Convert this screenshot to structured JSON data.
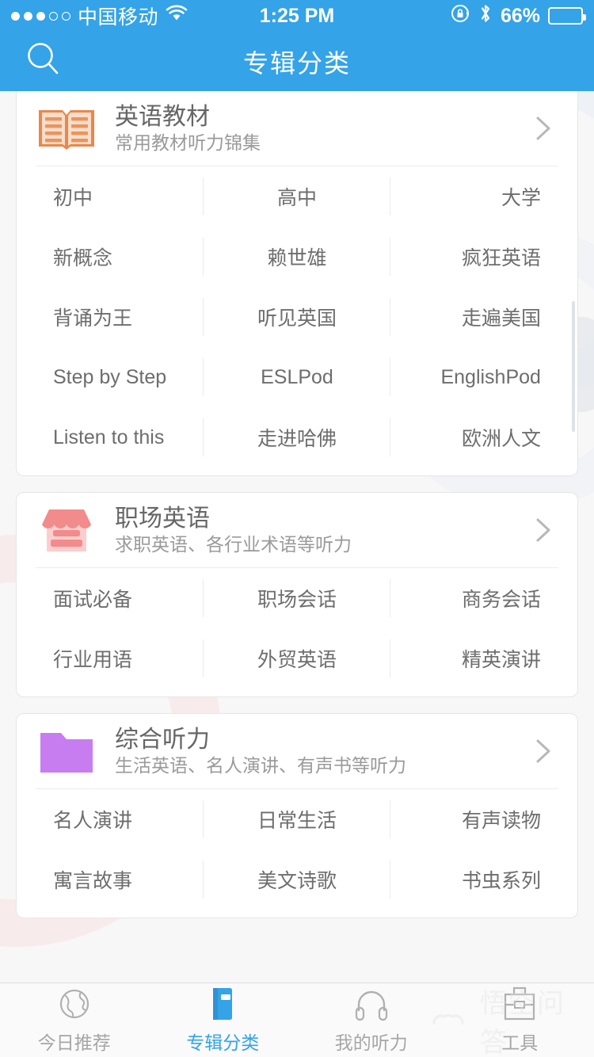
{
  "status_bar": {
    "signal_dots_filled": 3,
    "signal_dots_total": 5,
    "carrier": "中国移动",
    "wifi_icon": "wifi-icon",
    "time": "1:25 PM",
    "rotation_lock_icon": "rotation-lock-icon",
    "bluetooth_icon": "bluetooth-icon",
    "battery_percent": "66%",
    "battery_level": 66
  },
  "navbar": {
    "title": "专辑分类",
    "search_icon": "search-icon"
  },
  "theme": {
    "accent": "#34a3e8",
    "page_bg": "#f7f7f8",
    "card_bg": "#ffffff",
    "text_primary": "#666666",
    "text_secondary": "#9a9a9a",
    "grid_text": "#6d6d6d",
    "divider": "#ebebeb",
    "tab_inactive": "#a6a6a6"
  },
  "watermark": {
    "text": "悟空问答",
    "logo_icon": "wukong-cloud-icon"
  },
  "sections": [
    {
      "icon": "open-book-icon",
      "icon_color": "#e8884a",
      "title": "英语教材",
      "subtitle": "常用教材听力锦集",
      "chevron_icon": "chevron-right-icon",
      "items": [
        "初中",
        "高中",
        "大学",
        "新概念",
        "赖世雄",
        "疯狂英语",
        "背诵为王",
        "听见英国",
        "走遍美国",
        "Step by Step",
        "ESLPod",
        "EnglishPod",
        "Listen to this",
        "走进哈佛",
        "欧洲人文"
      ]
    },
    {
      "icon": "storefront-icon",
      "icon_color": "#f28b8b",
      "title": "职场英语",
      "subtitle": "求职英语、各行业术语等听力",
      "chevron_icon": "chevron-right-icon",
      "items": [
        "面试必备",
        "职场会话",
        "商务会话",
        "行业用语",
        "外贸英语",
        "精英演讲"
      ]
    },
    {
      "icon": "folder-sync-icon",
      "icon_color": "#c77df0",
      "title": "综合听力",
      "subtitle": "生活英语、名人演讲、有声书等听力",
      "chevron_icon": "chevron-right-icon",
      "items": [
        "名人演讲",
        "日常生活",
        "有声读物",
        "寓言故事",
        "美文诗歌",
        "书虫系列"
      ]
    }
  ],
  "tabbar": {
    "tabs": [
      {
        "label": "今日推荐",
        "icon": "globe-icon",
        "active": false
      },
      {
        "label": "专辑分类",
        "icon": "book-icon",
        "active": true
      },
      {
        "label": "我的听力",
        "icon": "headphones-icon",
        "active": false
      },
      {
        "label": "工具",
        "icon": "toolbox-icon",
        "active": false
      }
    ]
  }
}
